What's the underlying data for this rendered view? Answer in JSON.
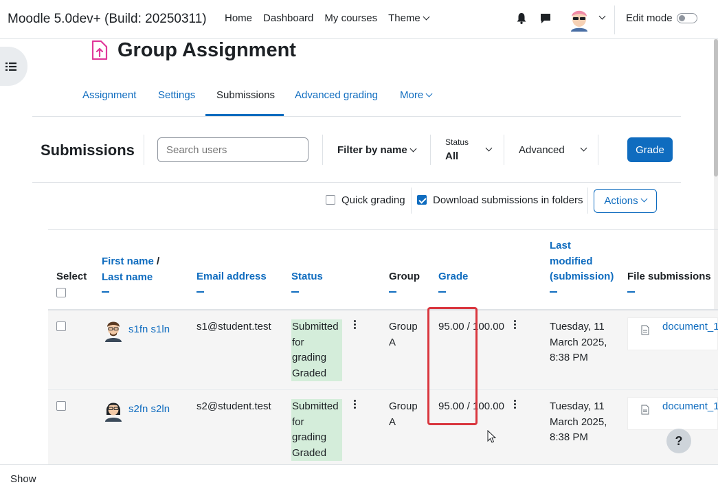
{
  "navbar": {
    "site_name": "Moodle 5.0dev+ (Build: 20250311)",
    "links": [
      "Home",
      "Dashboard",
      "My courses",
      "Theme"
    ],
    "edit_mode_label": "Edit mode"
  },
  "page": {
    "title": "Group Assignment"
  },
  "tabs": [
    {
      "label": "Assignment"
    },
    {
      "label": "Settings"
    },
    {
      "label": "Submissions",
      "active": true
    },
    {
      "label": "Advanced grading"
    },
    {
      "label": "More"
    }
  ],
  "submissions_header": {
    "title": "Submissions",
    "search_placeholder": "Search users",
    "filter_by_name": "Filter by name",
    "status_label": "Status",
    "status_value": "All",
    "advanced_label": "Advanced",
    "grade_button": "Grade"
  },
  "options": {
    "quick_grading": "Quick grading",
    "quick_grading_checked": false,
    "download_in_folders": "Download submissions in folders",
    "download_in_folders_checked": true,
    "actions_button": "Actions"
  },
  "table": {
    "headers": {
      "select": "Select",
      "first_name": "First name",
      "name_sep": "/",
      "last_name": "Last name",
      "email": "Email address",
      "status": "Status",
      "group": "Group",
      "grade": "Grade",
      "last_modified_1": "Last",
      "last_modified_2": "modified",
      "last_modified_3": "(submission)",
      "file_submissions": "File submissions"
    },
    "rows": [
      {
        "name": "s1fn s1ln",
        "email": "s1@student.test",
        "status_1": "Submitted",
        "status_2": "for",
        "status_3": "grading",
        "status_4": "Graded",
        "group_1": "Group",
        "group_2": "A",
        "grade": "95.00 / 100.00",
        "modified_1": "Tuesday, 11",
        "modified_2": "March 2025,",
        "modified_3": "8:38 PM",
        "file": "document_1"
      },
      {
        "name": "s2fn s2ln",
        "email": "s2@student.test",
        "status_1": "Submitted",
        "status_2": "for",
        "status_3": "grading",
        "status_4": "Graded",
        "group_1": "Group",
        "group_2": "A",
        "grade": "95.00 / 100.00",
        "modified_1": "Tuesday, 11",
        "modified_2": "March 2025,",
        "modified_3": "8:38 PM",
        "file": "document_1"
      }
    ]
  },
  "help_label": "?",
  "footer": {
    "show_label": "Show"
  },
  "colors": {
    "brand": "#0f6cbf",
    "status_green": "#d4edda",
    "highlight": "#d9363e"
  }
}
